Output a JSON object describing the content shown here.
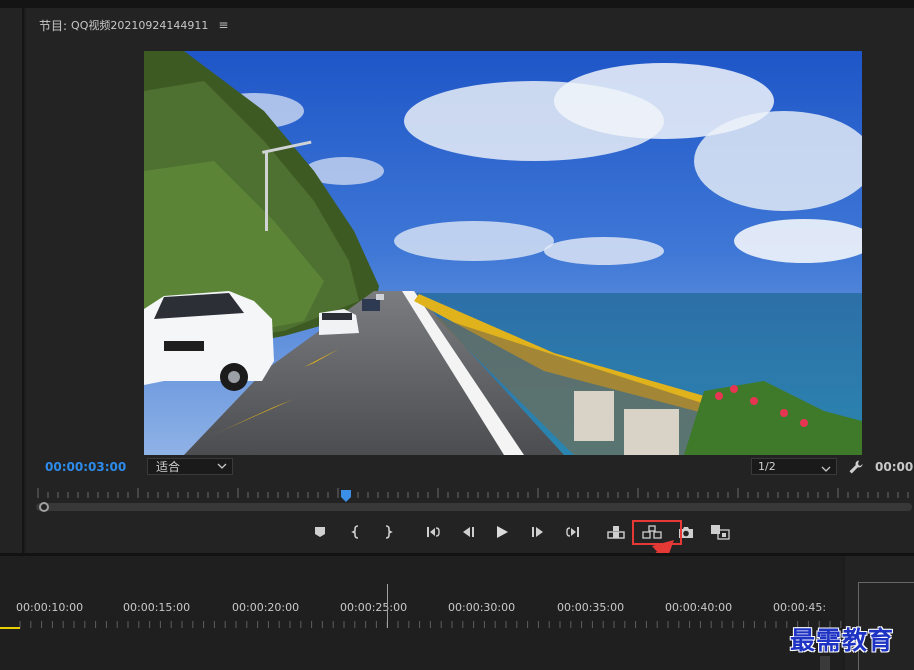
{
  "monitor": {
    "header_label": "节目:",
    "sequence_name": "QQ视频20210924144911",
    "menu_icon": "hamburger-menu-icon",
    "current_timecode": "00:00:03:00",
    "fit_zoom": "适合",
    "resolution": "1/2",
    "duration_timecode": "00:00:"
  },
  "transport": {
    "buttons": [
      {
        "name": "add-marker-button",
        "icon": "marker-icon"
      },
      {
        "name": "mark-in-button",
        "icon": "mark-in-icon"
      },
      {
        "name": "mark-out-button",
        "icon": "mark-out-icon"
      },
      {
        "name": "go-to-in-button",
        "icon": "go-to-in-icon"
      },
      {
        "name": "step-back-button",
        "icon": "step-back-icon"
      },
      {
        "name": "play-button",
        "icon": "play-icon"
      },
      {
        "name": "step-forward-button",
        "icon": "step-forward-icon"
      },
      {
        "name": "go-to-out-button",
        "icon": "go-to-out-icon"
      },
      {
        "name": "lift-button",
        "icon": "lift-icon"
      },
      {
        "name": "extract-button",
        "icon": "extract-icon"
      },
      {
        "name": "export-frame-button",
        "icon": "camera-icon"
      },
      {
        "name": "comparison-view-button",
        "icon": "comparison-view-icon"
      }
    ],
    "highlighted": "extract-button",
    "highlight_color": "#e53935"
  },
  "timeline": {
    "timecodes": [
      "00:00:10:00",
      "00:00:15:00",
      "00:00:20:00",
      "00:00:25:00",
      "00:00:30:00",
      "00:00:35:00",
      "00:00:40:00",
      "00:00:45:"
    ]
  },
  "colors": {
    "accent_timecode": "#2d8ceb",
    "playhead": "#3b8fe6",
    "highlight": "#e53935",
    "watermark": "#1e33c4"
  },
  "watermark": "最需教育"
}
